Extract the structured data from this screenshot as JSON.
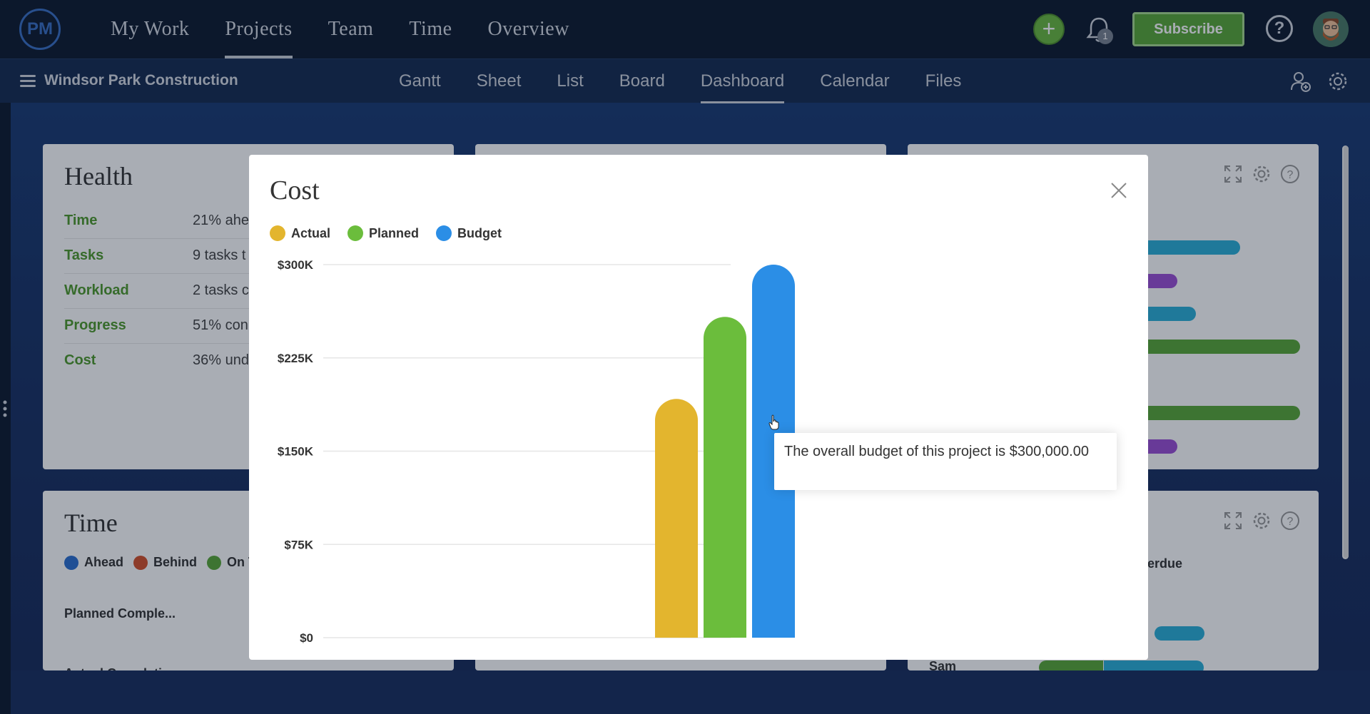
{
  "topnav": {
    "logo": "PM",
    "items": [
      "My Work",
      "Projects",
      "Team",
      "Time",
      "Overview"
    ],
    "active": "Projects",
    "notifications_count": "1",
    "subscribe_label": "Subscribe",
    "help_label": "?"
  },
  "subnav": {
    "project_name": "Windsor Park Construction",
    "tabs": [
      "Gantt",
      "Sheet",
      "List",
      "Board",
      "Dashboard",
      "Calendar",
      "Files"
    ],
    "active": "Dashboard"
  },
  "health": {
    "title": "Health",
    "rows": [
      {
        "key": "Time",
        "value": "21% ahe"
      },
      {
        "key": "Tasks",
        "value": "9 tasks t"
      },
      {
        "key": "Workload",
        "value": "2 tasks c"
      },
      {
        "key": "Progress",
        "value": "51% con"
      },
      {
        "key": "Cost",
        "value": "36% und"
      }
    ]
  },
  "time_panel": {
    "title": "Time",
    "legend": [
      "Ahead",
      "Behind",
      "On T"
    ],
    "rows": [
      "Planned Comple...",
      "Actual Completi..."
    ]
  },
  "right_lower_panel": {
    "legend_fragment": "verdue",
    "row_label": "Sam"
  },
  "modal": {
    "title": "Cost",
    "legend": [
      {
        "label": "Actual",
        "color": "#e3b52e"
      },
      {
        "label": "Planned",
        "color": "#6bbd3c"
      },
      {
        "label": "Budget",
        "color": "#2b8ee6"
      }
    ],
    "tooltip": "The overall budget of this project is $300,000.00"
  },
  "chart_data": {
    "type": "bar",
    "categories": [
      "Actual",
      "Planned",
      "Budget"
    ],
    "series": [
      {
        "name": "Actual",
        "values": [
          192000
        ],
        "color": "#e3b52e"
      },
      {
        "name": "Planned",
        "values": [
          258000
        ],
        "color": "#6bbd3c"
      },
      {
        "name": "Budget",
        "values": [
          300000
        ],
        "color": "#2b8ee6"
      }
    ],
    "ytick_labels": [
      "$0",
      "$75K",
      "$150K",
      "$225K",
      "$300K"
    ],
    "ytick_values": [
      0,
      75000,
      150000,
      225000,
      300000
    ],
    "ylim": [
      0,
      300000
    ],
    "grid": true,
    "legend": "top-left"
  }
}
